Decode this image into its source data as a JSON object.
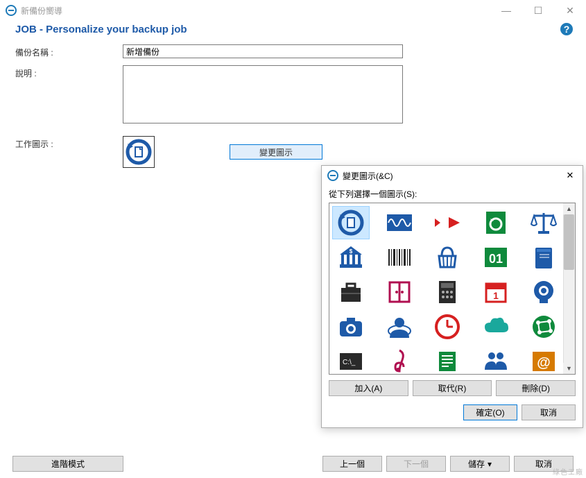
{
  "window": {
    "title": "新備份嚮導",
    "minimize": "—",
    "maximize": "☐",
    "close": "✕"
  },
  "page": {
    "title": "JOB - Personalize your backup job"
  },
  "form": {
    "name_label": "備份名稱 :",
    "name_value": "新增備份",
    "desc_label": "說明 :",
    "desc_value": "",
    "icon_label": "工作圖示 :",
    "change_icon_btn": "變更圖示"
  },
  "footer": {
    "advanced": "進階模式",
    "prev": "上一個",
    "next": "下一個",
    "save": "儲存",
    "cancel": "取消"
  },
  "dialog": {
    "title": "變更圖示(&C)",
    "list_label": "從下列選擇一個圖示(S):",
    "add": "加入(A)",
    "replace": "取代(R)",
    "delete": "刪除(D)",
    "ok": "確定(O)",
    "cancel": "取消",
    "selected_icon": "backup-restore"
  },
  "icons": {
    "grid": [
      {
        "name": "backup-restore",
        "selected": true
      },
      {
        "name": "audio-wave"
      },
      {
        "name": "arrow-fast"
      },
      {
        "name": "backup-doc-green"
      },
      {
        "name": "balance-scale"
      },
      {
        "name": "bank"
      },
      {
        "name": "barcode"
      },
      {
        "name": "basket"
      },
      {
        "name": "binary-01"
      },
      {
        "name": "book"
      },
      {
        "name": "briefcase"
      },
      {
        "name": "cabinet"
      },
      {
        "name": "calculator"
      },
      {
        "name": "calendar"
      },
      {
        "name": "webcam"
      },
      {
        "name": "camera"
      },
      {
        "name": "user-circle"
      },
      {
        "name": "clock"
      },
      {
        "name": "cloud"
      },
      {
        "name": "globe-network"
      },
      {
        "name": "command-prompt"
      },
      {
        "name": "treble-clef"
      },
      {
        "name": "document-lines"
      },
      {
        "name": "users-group"
      },
      {
        "name": "at-sign"
      }
    ]
  },
  "watermark": "綠色工廠"
}
